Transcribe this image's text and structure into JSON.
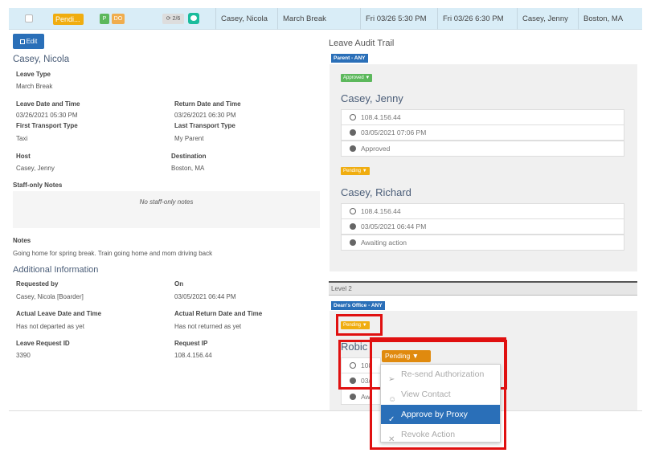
{
  "row": {
    "status": "Pendi...",
    "tag_p": "P",
    "tag_do": "DO",
    "count": "2/6",
    "student": "Casey, Nicola",
    "leave_type": "March Break",
    "leave_date": "Fri 03/26 5:30 PM",
    "return_date": "Fri 03/26 6:30 PM",
    "host": "Casey, Jenny",
    "destination": "Boston, MA"
  },
  "detail": {
    "edit_label": "Edit",
    "name": "Casey, Nicola",
    "leave_type_label": "Leave Type",
    "leave_type": "March Break",
    "leave_dt_label": "Leave Date and Time",
    "leave_dt": "03/26/2021 05:30 PM",
    "return_dt_label": "Return Date and Time",
    "return_dt": "03/26/2021 06:30 PM",
    "first_transport_label": "First Transport Type",
    "first_transport": "Taxi",
    "last_transport_label": "Last Transport Type",
    "last_transport": "My Parent",
    "host_label": "Host",
    "host": "Casey, Jenny",
    "destination_label": "Destination",
    "destination": "Boston, MA",
    "staff_notes_label": "Staff-only Notes",
    "staff_notes_empty": "No staff-only notes",
    "notes_label": "Notes",
    "notes": "Going home for spring break. Train going home and mom driving back",
    "additional_title": "Additional Information",
    "requested_by_label": "Requested by",
    "requested_by": "Casey, Nicola [Boarder]",
    "on_label": "On",
    "on": "03/05/2021 06:44 PM",
    "actual_leave_label": "Actual Leave Date and Time",
    "actual_leave": "Has not departed as yet",
    "actual_return_label": "Actual Return Date and Time",
    "actual_return": "Has not returned as yet",
    "request_id_label": "Leave Request ID",
    "request_id": "3390",
    "request_ip_label": "Request IP",
    "request_ip": "108.4.156.44"
  },
  "audit": {
    "title": "Leave Audit Trail",
    "parent_role": "Parent - ANY",
    "entry1": {
      "status": "Approved",
      "name": "Casey, Jenny",
      "ip": "108.4.156.44",
      "time": "03/05/2021 07:06 PM",
      "state": "Approved"
    },
    "entry2": {
      "status": "Pending",
      "name": "Casey, Richard",
      "ip": "108.4.156.44",
      "time": "03/05/2021 06:44 PM",
      "state": "Awaiting action"
    },
    "level2": "Level 2",
    "dean_role": "Dean's Office - ANY",
    "entry3": {
      "status": "Pending",
      "name": "Robic",
      "ip": "108",
      "time": "03/",
      "state": "Aw"
    }
  },
  "dropdown": {
    "button": "Pending",
    "items": [
      "Re-send Authorization",
      "View Contact",
      "Approve by Proxy",
      "Revoke Action"
    ]
  },
  "colors": {
    "accent": "#2a6fb8",
    "pending": "#f0ad10",
    "approved": "#5cb85c",
    "highlight": "#e01010"
  }
}
